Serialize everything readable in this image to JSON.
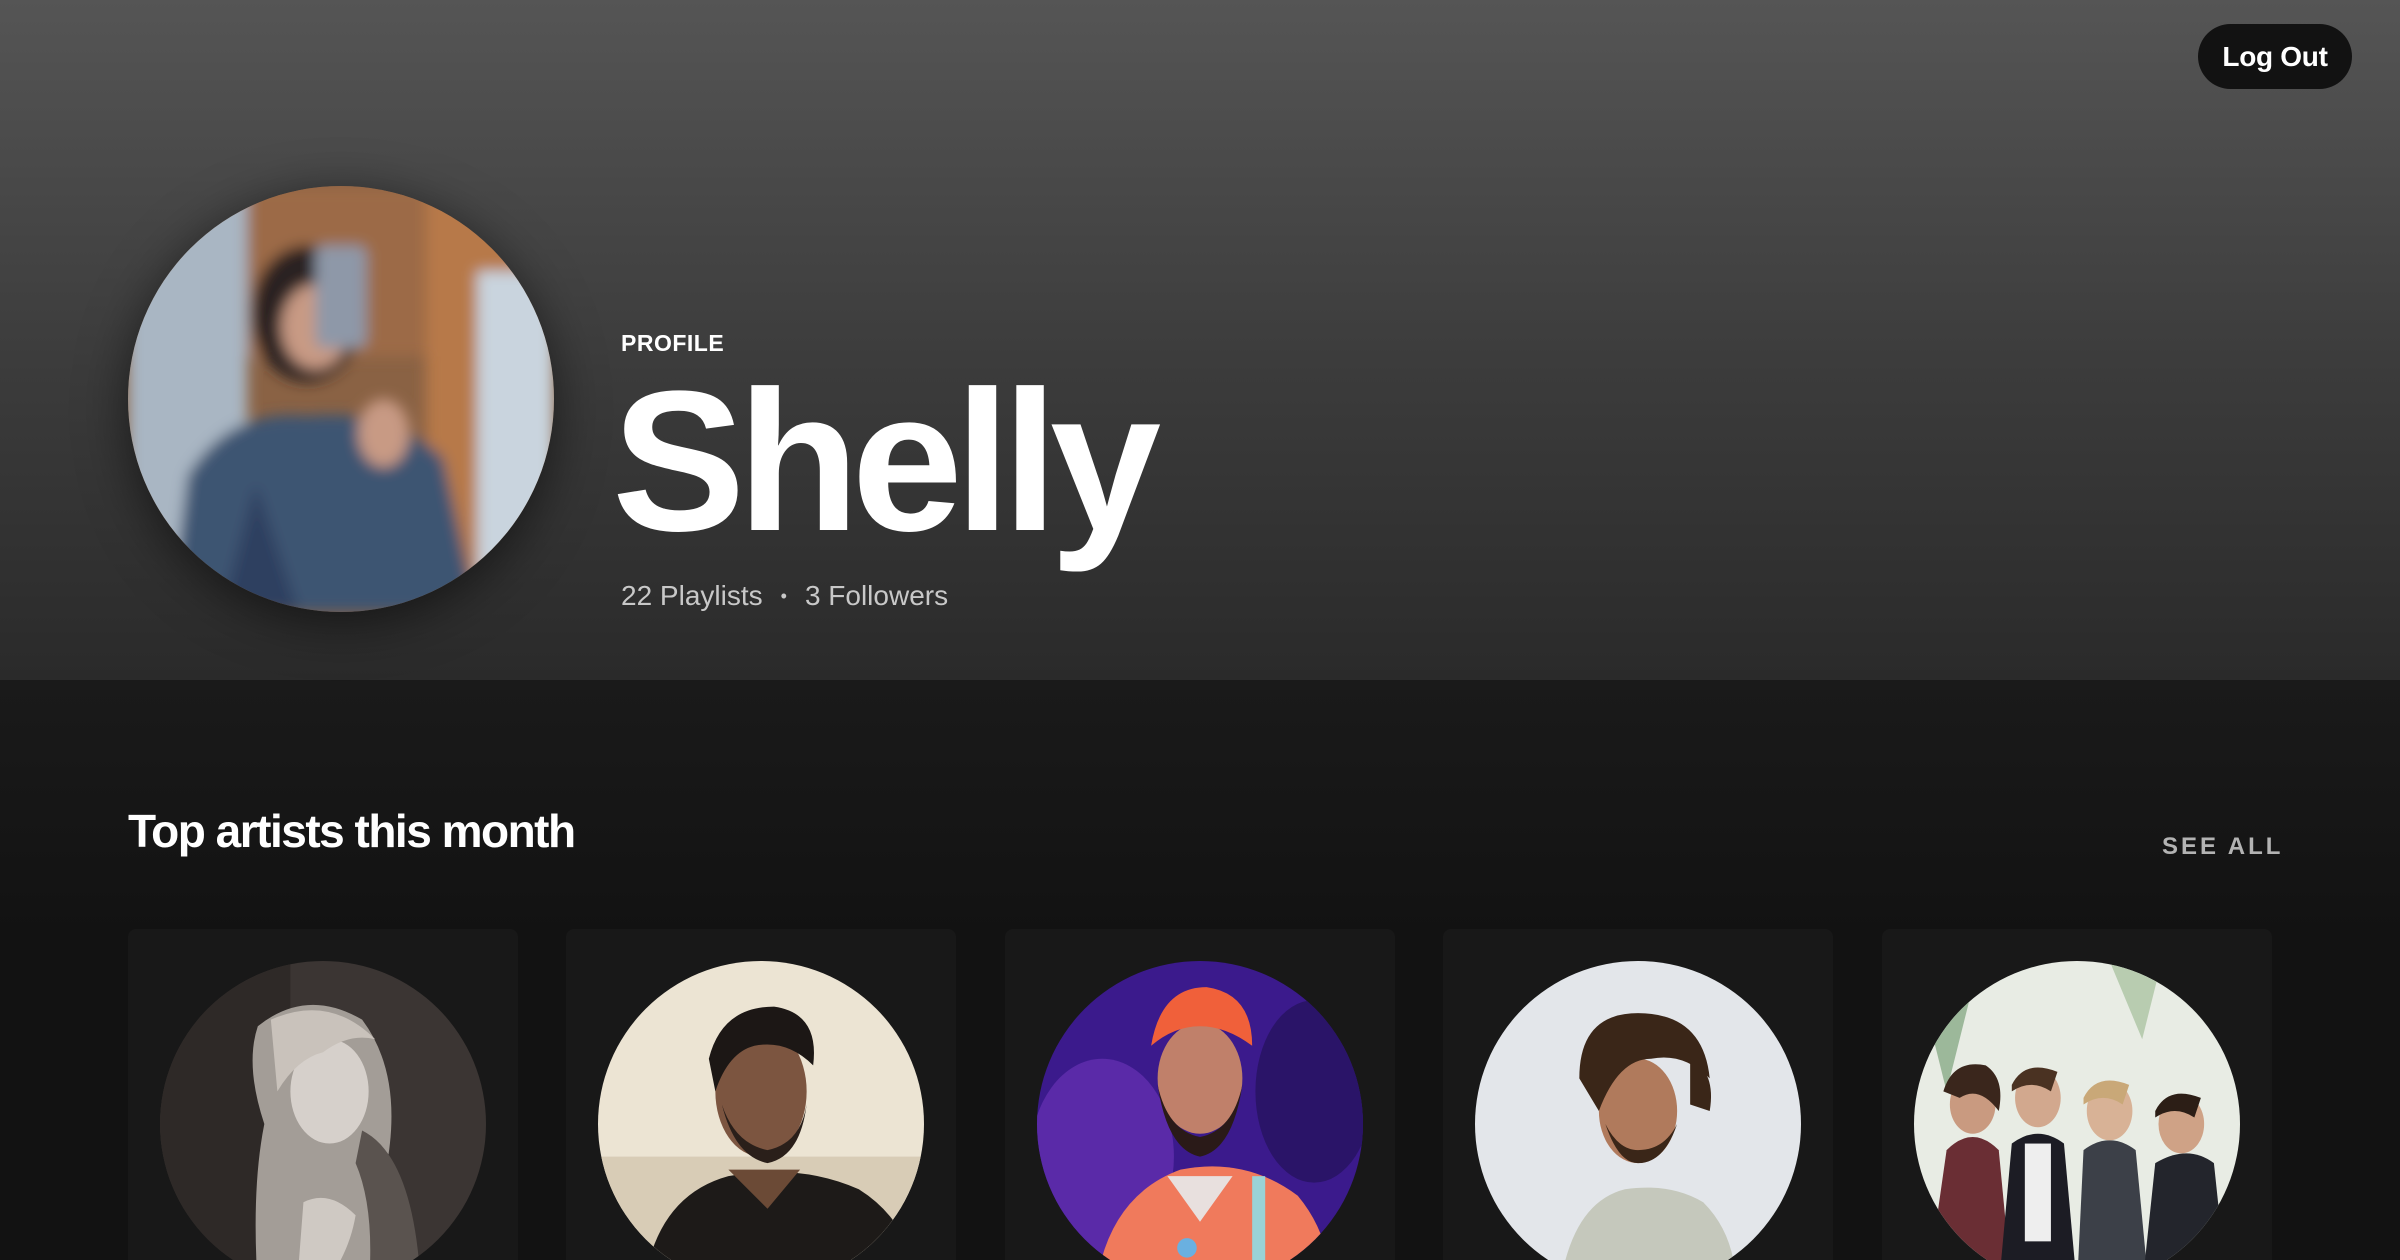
{
  "header": {
    "logout_label": "Log Out"
  },
  "profile": {
    "label": "PROFILE",
    "name": "Shelly",
    "playlists": "22 Playlists",
    "separator": "•",
    "followers": "3 Followers"
  },
  "top_artists": {
    "title": "Top artists this month",
    "see_all_label": "SEE ALL",
    "artists": [
      {
        "image": "artist-1-photo"
      },
      {
        "image": "artist-2-photo"
      },
      {
        "image": "artist-3-photo"
      },
      {
        "image": "artist-4-photo"
      },
      {
        "image": "artist-5-photo"
      }
    ]
  },
  "colors": {
    "background": "#121212",
    "card": "#181818",
    "header_top": "#555555",
    "header_bottom": "#2a2a2a",
    "muted_text": "#b3b3b3"
  }
}
